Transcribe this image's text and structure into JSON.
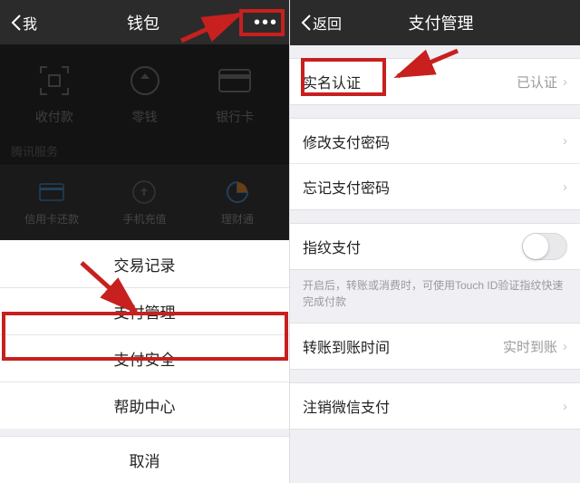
{
  "left": {
    "back_label": "我",
    "title": "钱包",
    "top_icons": {
      "receive_pay": "收付款",
      "balance": "零钱",
      "bank_card": "银行卡"
    },
    "section_label": "腾讯服务",
    "services": {
      "credit_card": "信用卡还款",
      "mobile_topup": "手机充值",
      "licaitong": "理财通"
    },
    "sheet": {
      "transaction_records": "交易记录",
      "payment_management": "支付管理",
      "payment_security": "支付安全",
      "help_center": "帮助中心",
      "cancel": "取消"
    }
  },
  "right": {
    "back_label": "返回",
    "title": "支付管理",
    "cells": {
      "real_name": "实名认证",
      "real_name_value": "已认证",
      "change_pwd": "修改支付密码",
      "forgot_pwd": "忘记支付密码",
      "touch_pay": "指纹支付",
      "touch_hint": "开启后，转账或消费时，可使用Touch ID验证指纹快速完成付款",
      "transfer_time": "转账到账时间",
      "transfer_time_value": "实时到账",
      "deregister": "注销微信支付"
    }
  }
}
